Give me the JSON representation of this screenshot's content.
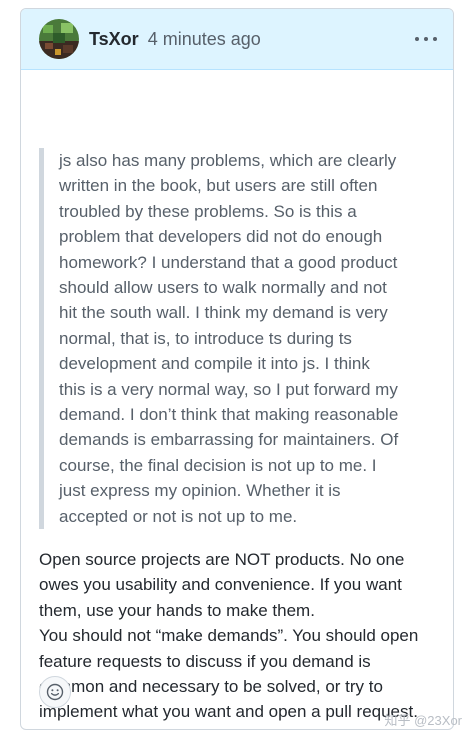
{
  "comment": {
    "author": "TsXor",
    "timestamp": "4 minutes ago",
    "quote_lines": [
      "js also has many problems, which are clearly",
      "written in the book, but users are still often",
      "troubled by these problems. So is this a",
      "problem that developers did not do enough",
      "homework? I understand that a good product",
      "should allow users to walk normally and not",
      "hit the south wall. I think my demand is very",
      "normal, that is, to introduce ts during ts",
      "development and compile it into js. I think",
      "this is a very normal way, so I put forward my",
      "demand. I don’t think that making reasonable",
      "demands is embarrassing for maintainers. Of",
      "course, the final decision is not up to me. I",
      "just express my opinion. Whether it is",
      "accepted or not is not up to me."
    ],
    "reply_lines": [
      "Open source projects are NOT products. No one",
      "owes you usability and convenience. If you want",
      "them, use your hands to make them.",
      "You should not “make demands”. You should open",
      "feature requests to discuss if you demand is",
      "common and necessary to be solved, or try to",
      "implement what you want and open a pull request."
    ]
  },
  "watermark": "知乎 @23Xor",
  "colors": {
    "header_bg": "#ddf4ff",
    "border": "#d0d7de",
    "quote_text": "#57606a",
    "body_text": "#24292f"
  },
  "icons": {
    "avatar": "avatar",
    "menu": "kebab-horizontal-icon",
    "reaction": "smiley-icon"
  }
}
